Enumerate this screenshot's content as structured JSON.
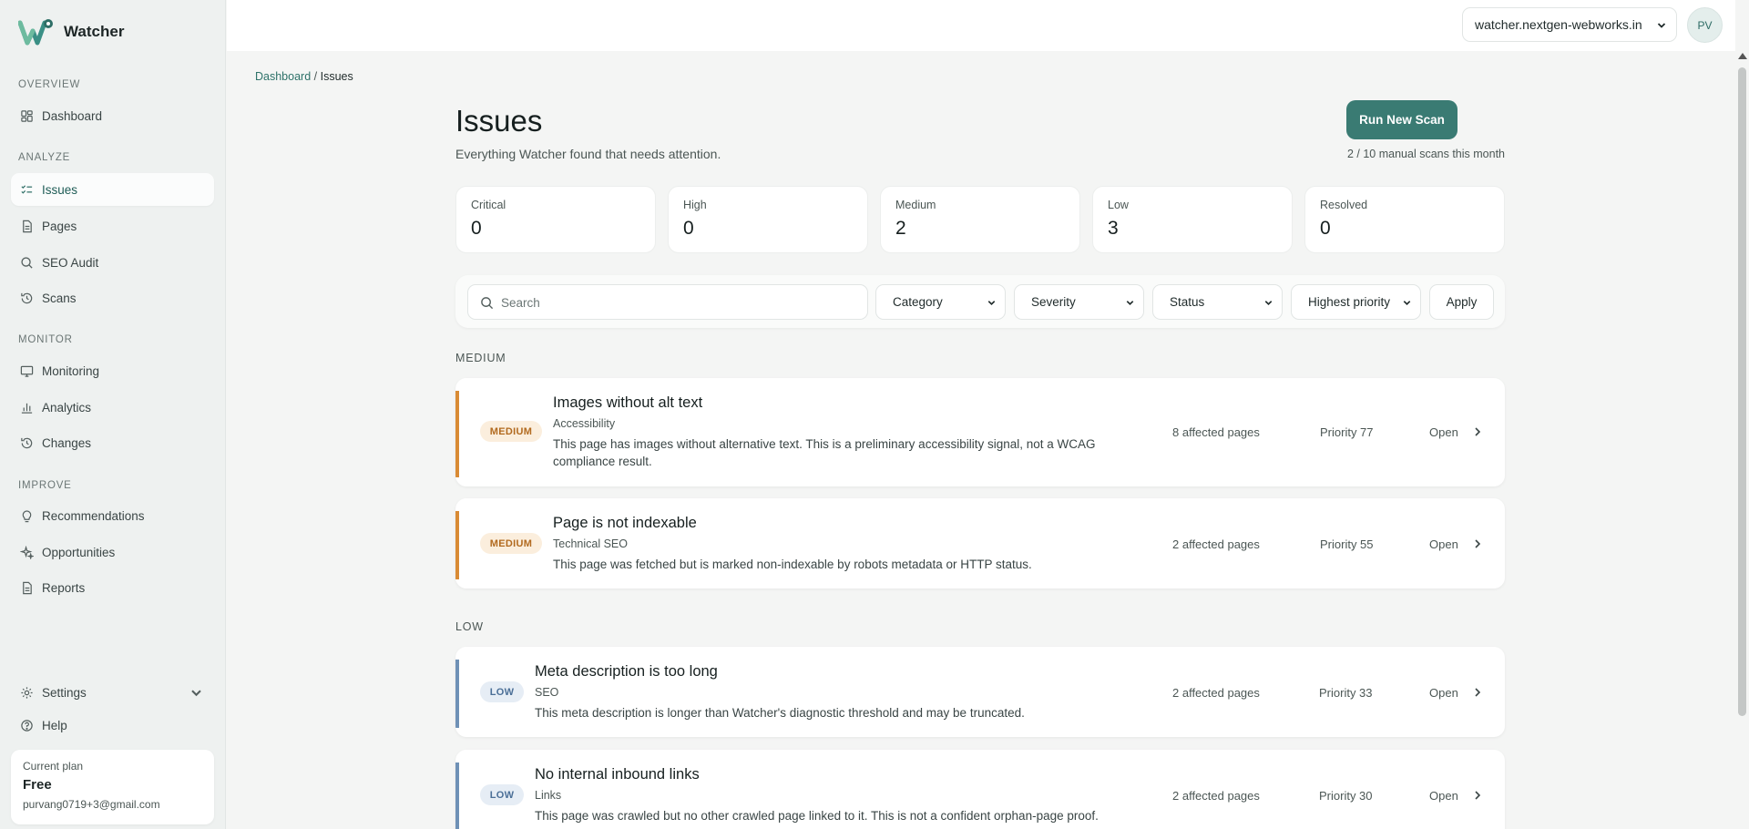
{
  "app": {
    "name": "Watcher"
  },
  "sidebar": {
    "sections": {
      "overview": "OVERVIEW",
      "analyze": "ANALYZE",
      "monitor": "MONITOR",
      "improve": "IMPROVE"
    },
    "items": [
      {
        "label": "Dashboard",
        "icon": "dashboard-icon"
      },
      {
        "label": "Issues",
        "icon": "checklist-icon",
        "active": true
      },
      {
        "label": "Pages",
        "icon": "page-icon"
      },
      {
        "label": "SEO Audit",
        "icon": "search-icon"
      },
      {
        "label": "Scans",
        "icon": "history-icon"
      },
      {
        "label": "Monitoring",
        "icon": "monitor-icon"
      },
      {
        "label": "Analytics",
        "icon": "bar-chart-icon"
      },
      {
        "label": "Changes",
        "icon": "history-icon"
      },
      {
        "label": "Recommendations",
        "icon": "lightbulb-icon"
      },
      {
        "label": "Opportunities",
        "icon": "sparkle-icon"
      },
      {
        "label": "Reports",
        "icon": "page-icon"
      }
    ],
    "settings": "Settings",
    "help": "Help",
    "plan": {
      "label": "Current plan",
      "name": "Free",
      "email": "purvang0719+3@gmail.com"
    }
  },
  "topbar": {
    "site": "watcher.nextgen-webworks.in",
    "avatar": "PV"
  },
  "breadcrumb": {
    "parent": "Dashboard",
    "separator": "/",
    "current": "Issues"
  },
  "page": {
    "title": "Issues",
    "subtitle": "Everything Watcher found that needs attention.",
    "run_button": "Run New Scan",
    "scan_quota": "2 / 10 manual scans this month"
  },
  "stats": [
    {
      "label": "Critical",
      "value": "0"
    },
    {
      "label": "High",
      "value": "0"
    },
    {
      "label": "Medium",
      "value": "2"
    },
    {
      "label": "Low",
      "value": "3"
    },
    {
      "label": "Resolved",
      "value": "0"
    }
  ],
  "filters": {
    "search_placeholder": "Search",
    "category": "Category",
    "severity": "Severity",
    "status": "Status",
    "sort": "Highest priority",
    "apply": "Apply"
  },
  "groups": {
    "medium": "MEDIUM",
    "low": "LOW"
  },
  "issues": [
    {
      "severity": "MEDIUM",
      "title": "Images without alt text",
      "category": "Accessibility",
      "description": "This page has images without alternative text. This is a preliminary accessibility signal, not a WCAG compliance result.",
      "pages": "8 affected pages",
      "priority": "Priority 77",
      "status": "Open"
    },
    {
      "severity": "MEDIUM",
      "title": "Page is not indexable",
      "category": "Technical SEO",
      "description": "This page was fetched but is marked non-indexable by robots metadata or HTTP status.",
      "pages": "2 affected pages",
      "priority": "Priority 55",
      "status": "Open"
    },
    {
      "severity": "LOW",
      "title": "Meta description is too long",
      "category": "SEO",
      "description": "This meta description is longer than Watcher's diagnostic threshold and may be truncated.",
      "pages": "2 affected pages",
      "priority": "Priority 33",
      "status": "Open"
    },
    {
      "severity": "LOW",
      "title": "No internal inbound links",
      "category": "Links",
      "description": "This page was crawled but no other crawled page linked to it. This is not a confident orphan-page proof.",
      "pages": "2 affected pages",
      "priority": "Priority 30",
      "status": "Open"
    }
  ],
  "colors": {
    "accent": "#3a7b73",
    "medium": "#d98b35",
    "low": "#6f91b6"
  }
}
